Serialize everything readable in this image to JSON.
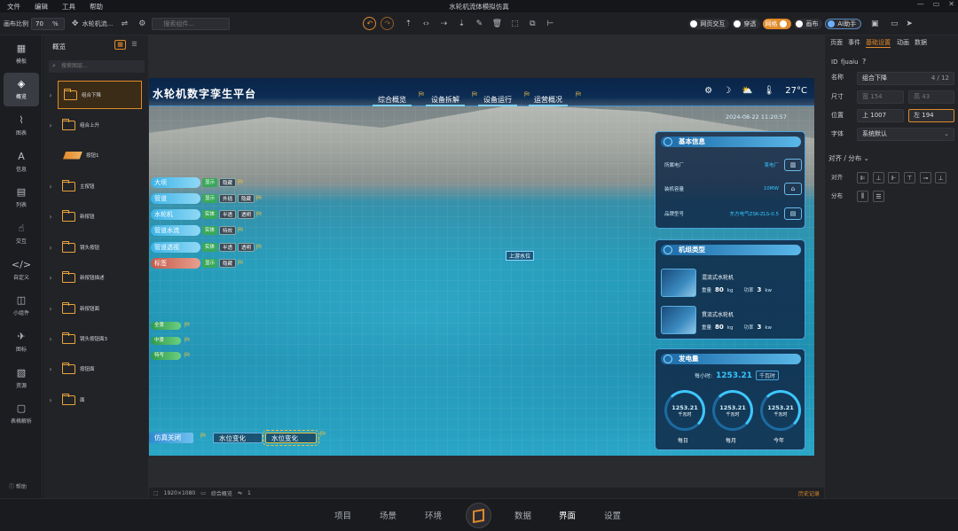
{
  "menubar": {
    "items": [
      "文件",
      "编辑",
      "工具",
      "帮助"
    ],
    "title": "水轮机流体模拟仿真",
    "win": [
      "—",
      "▭",
      "✕"
    ]
  },
  "toolbar": {
    "scale_label": "画布比例",
    "scale_value": "70",
    "scale_unit": "%",
    "component_label": "水轮机流...",
    "search_placeholder": "搜索组件...",
    "toggles": [
      {
        "label": "网页交互",
        "on": false
      },
      {
        "label": "穿透",
        "on": false
      },
      {
        "label": "网格",
        "on": true
      },
      {
        "label": "画布",
        "on": false
      }
    ],
    "ai_label": "AI助手"
  },
  "leftnav": {
    "items": [
      {
        "label": "模板",
        "icon": "▦"
      },
      {
        "label": "概览",
        "icon": "◈"
      },
      {
        "label": "图表",
        "icon": "⌇"
      },
      {
        "label": "信息",
        "icon": "A"
      },
      {
        "label": "列表",
        "icon": "▤"
      },
      {
        "label": "交互",
        "icon": "☝"
      },
      {
        "label": "自定义",
        "icon": "</>"
      },
      {
        "label": "小组件",
        "icon": "◫"
      },
      {
        "label": "图标",
        "icon": "✈"
      },
      {
        "label": "资源",
        "icon": "▧"
      },
      {
        "label": "表格解析",
        "icon": "▢"
      }
    ],
    "help": "帮助"
  },
  "layers": {
    "title": "概览",
    "search_placeholder": "搜索图层...",
    "items": [
      {
        "label": "组合下降",
        "type": "folder",
        "selected": true
      },
      {
        "label": "组合上升",
        "type": "folder"
      },
      {
        "label": "按钮1",
        "type": "button"
      },
      {
        "label": "主按钮",
        "type": "folder"
      },
      {
        "label": "新按钮",
        "type": "folder"
      },
      {
        "label": "镜头按钮",
        "type": "folder"
      },
      {
        "label": "新按钮描述",
        "type": "folder"
      },
      {
        "label": "新按钮面",
        "type": "folder"
      },
      {
        "label": "镜头按钮面3",
        "type": "folder"
      },
      {
        "label": "按钮面",
        "type": "folder"
      },
      {
        "label": "面",
        "type": "folder"
      }
    ]
  },
  "scene": {
    "title": "水轮机数字孪生平台",
    "tabs": [
      "综合概览",
      "设备拆解",
      "设备运行",
      "运营概况"
    ],
    "temperature": "27°C",
    "datetime": "2024-08-22 11:20:57",
    "controls": [
      {
        "name": "大坝",
        "chips": [
          "显示",
          "隐藏"
        ]
      },
      {
        "name": "管道",
        "chips": [
          "显示",
          "外插",
          "隐藏"
        ]
      },
      {
        "name": "水轮机",
        "chips": [
          "实体",
          "半透",
          "透明"
        ]
      },
      {
        "name": "管道水流",
        "chips": [
          "实体",
          "特效"
        ]
      },
      {
        "name": "管道透视",
        "chips": [
          "实体",
          "半透",
          "透明"
        ]
      },
      {
        "name": "标签",
        "chips": [
          "显示",
          "隐藏"
        ],
        "red": true
      }
    ],
    "pills": [
      "全景",
      "中景",
      "特写"
    ],
    "water_label": "上游水位",
    "bottom_buttons": [
      "仿真关闭",
      "水位变化",
      "水位变化"
    ],
    "info_panel": {
      "title": "基本信息",
      "rows": [
        {
          "k": "所属电厂",
          "v": "某电厂"
        },
        {
          "k": "装机容量",
          "v": "10MW"
        },
        {
          "k": "品牌型号",
          "v": "东方电气ZSK-ZLS-0.5"
        }
      ]
    },
    "units_panel": {
      "title": "机组类型",
      "units": [
        {
          "name": "混流式水轮机",
          "k1": "重量",
          "v1": "80",
          "u1": "kg",
          "k2": "功率",
          "v2": "3",
          "u2": "kw"
        },
        {
          "name": "贯流式水轮机",
          "k1": "重量",
          "v1": "80",
          "u1": "kg",
          "k2": "功率",
          "v2": "3",
          "u2": "kw"
        }
      ]
    },
    "power_panel": {
      "title": "发电量",
      "hourly_label": "每小时:",
      "hourly_value": "1253.21",
      "hourly_unit": "千瓦时",
      "rings": [
        {
          "value": "1253.21",
          "unit": "千瓦时",
          "label": "每日"
        },
        {
          "value": "1253.21",
          "unit": "千瓦时",
          "label": "每月"
        },
        {
          "value": "1253.21",
          "unit": "千瓦时",
          "label": "今年"
        }
      ]
    }
  },
  "statusbar": {
    "size": "1920×1080",
    "page": "综合概览",
    "count": "1",
    "history": "历史记录"
  },
  "rightpanel": {
    "tabs": [
      "页面",
      "事件",
      "基础设置",
      "动画",
      "数据"
    ],
    "id_label": "ID",
    "id_value": "fjuaiu",
    "name_label": "名称",
    "name_value": "组合下降",
    "name_count": "4 / 12",
    "size_label": "尺寸",
    "width_prefix": "宽",
    "width_value": "154",
    "height_prefix": "高",
    "height_value": "43",
    "pos_label": "位置",
    "top_prefix": "上",
    "top_value": "1007",
    "left_prefix": "左",
    "left_value": "194",
    "font_label": "字体",
    "font_value": "系统默认",
    "align_section": "对齐 / 分布",
    "align_label": "对齐",
    "dist_label": "分布"
  },
  "bottomnav": {
    "items": [
      "项目",
      "场景",
      "环境",
      "数据",
      "界面",
      "设置"
    ],
    "active": "界面"
  }
}
